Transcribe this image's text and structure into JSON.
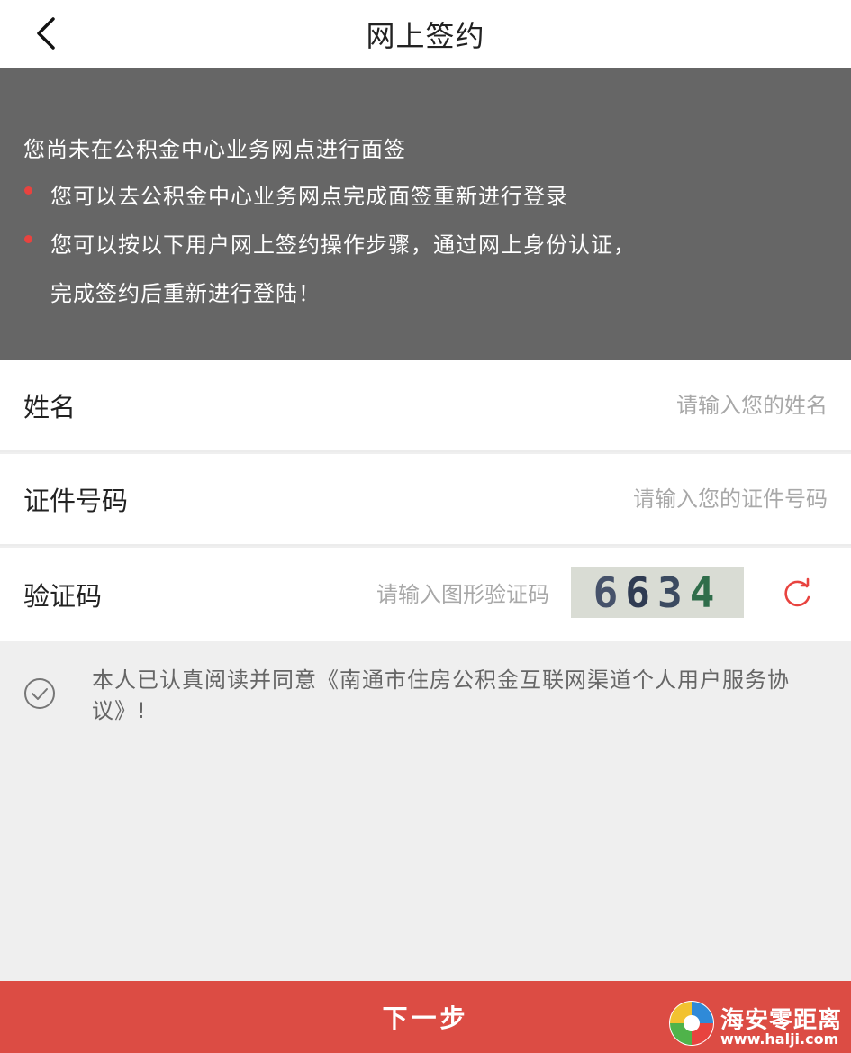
{
  "header": {
    "title": "网上签约",
    "back_icon": "chevron-left-icon"
  },
  "notice": {
    "line1": "您尚未在公积金中心业务网点进行面签",
    "bullet1": "您可以去公积金中心业务网点完成面签重新进行登录",
    "bullet2_line1": "您可以按以下用户网上签约操作步骤，通过网上身份认证，",
    "bullet2_line2": "完成签约后重新进行登陆！",
    "background": "#666666",
    "bullet_color": "#e8433f"
  },
  "form": {
    "name": {
      "label": "姓名",
      "placeholder": "请输入您的姓名",
      "value": ""
    },
    "id_number": {
      "label": "证件号码",
      "placeholder": "请输入您的证件号码",
      "value": ""
    },
    "captcha": {
      "label": "验证码",
      "placeholder": "请输入图形验证码",
      "value": "",
      "image_text": "6634"
    }
  },
  "agreement": {
    "text": "本人已认真阅读并同意《南通市住房公积金互联网渠道个人用户服务协议》!",
    "icon": "check-circle-icon"
  },
  "footer": {
    "next_label": "下一步",
    "button_color": "#dc4c44"
  },
  "watermark": {
    "name": "海安零距离",
    "url": "www.halji.com"
  }
}
